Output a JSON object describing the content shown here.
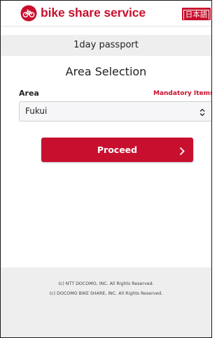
{
  "header": {
    "brand": "bike share service",
    "language_button": "日本語",
    "brand_color": "#c8102e"
  },
  "subheader": {
    "title": "1day passport"
  },
  "main": {
    "title": "Area Selection",
    "area_label": "Area",
    "mandatory_label": "Mandatory Items",
    "area_select": {
      "value": "Fukui"
    },
    "proceed_label": "Proceed"
  },
  "footer": {
    "lines": [
      "(c) NTT DOCOMO, INC. All Rights Reserved.",
      "(c) DOCOMO BIKE SHARE, INC. All Rights Reserved."
    ]
  },
  "icons": {
    "logo": "bike-logo-icon",
    "select_arrow": "select-updown-icon",
    "proceed_chevron": "chevron-right-icon"
  }
}
